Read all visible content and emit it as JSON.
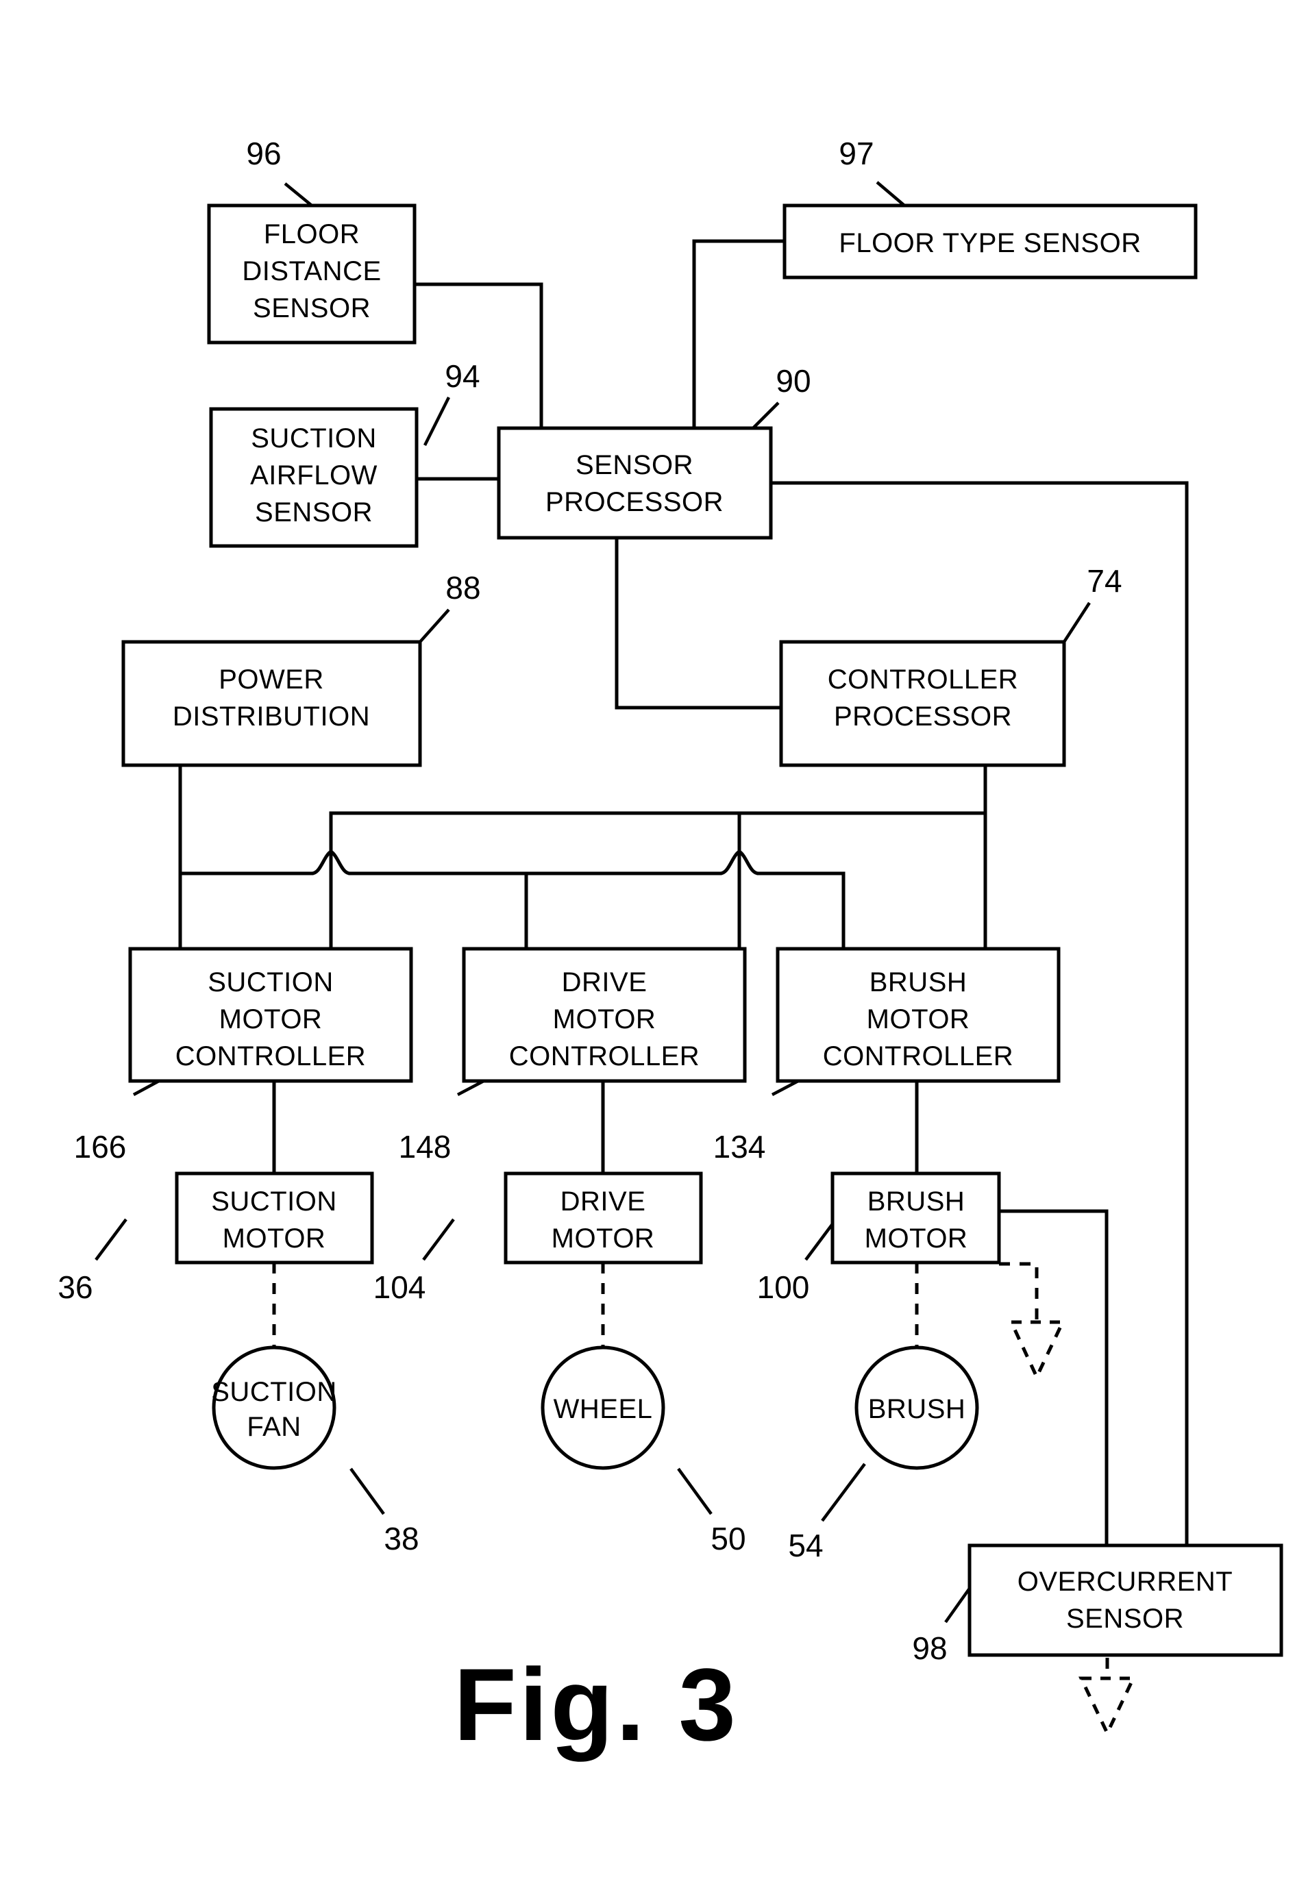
{
  "figure": {
    "caption": "Fig. 3",
    "title": "Vacuum cleaner control system block diagram"
  },
  "blocks": {
    "floor_distance_sensor": {
      "lines": [
        "FLOOR",
        "DISTANCE",
        "SENSOR"
      ],
      "ref": "96"
    },
    "floor_type_sensor": {
      "lines": [
        "FLOOR TYPE SENSOR"
      ],
      "ref": "97"
    },
    "suction_airflow_sensor": {
      "lines": [
        "SUCTION",
        "AIRFLOW",
        "SENSOR"
      ],
      "ref": "94"
    },
    "sensor_processor": {
      "lines": [
        "SENSOR",
        "PROCESSOR"
      ],
      "ref": "90"
    },
    "power_distribution": {
      "lines": [
        "POWER",
        "DISTRIBUTION"
      ],
      "ref": "88"
    },
    "controller_processor": {
      "lines": [
        "CONTROLLER",
        "PROCESSOR"
      ],
      "ref": "74"
    },
    "suction_motor_controller": {
      "lines": [
        "SUCTION",
        "MOTOR",
        "CONTROLLER"
      ],
      "ref": "166"
    },
    "drive_motor_controller": {
      "lines": [
        "DRIVE",
        "MOTOR",
        "CONTROLLER"
      ],
      "ref": "148"
    },
    "brush_motor_controller": {
      "lines": [
        "BRUSH",
        "MOTOR",
        "CONTROLLER"
      ],
      "ref": "134"
    },
    "suction_motor": {
      "lines": [
        "SUCTION",
        "MOTOR"
      ],
      "ref": "36"
    },
    "drive_motor": {
      "lines": [
        "DRIVE",
        "MOTOR"
      ],
      "ref": "104"
    },
    "brush_motor": {
      "lines": [
        "BRUSH",
        "MOTOR"
      ],
      "ref": "100"
    },
    "suction_fan": {
      "lines": [
        "SUCTION",
        "FAN"
      ],
      "ref": "38"
    },
    "wheel": {
      "lines": [
        "WHEEL"
      ],
      "ref": "50"
    },
    "brush": {
      "lines": [
        "BRUSH"
      ],
      "ref": "54"
    },
    "overcurrent_sensor": {
      "lines": [
        "OVERCURRENT",
        "SENSOR"
      ],
      "ref": "98"
    }
  },
  "labels": {
    "floor_distance_sensor_l1": "FLOOR",
    "floor_distance_sensor_l2": "DISTANCE",
    "floor_distance_sensor_l3": "SENSOR",
    "floor_type_sensor_l1": "FLOOR TYPE SENSOR",
    "suction_airflow_sensor_l1": "SUCTION",
    "suction_airflow_sensor_l2": "AIRFLOW",
    "suction_airflow_sensor_l3": "SENSOR",
    "sensor_processor_l1": "SENSOR",
    "sensor_processor_l2": "PROCESSOR",
    "power_distribution_l1": "POWER",
    "power_distribution_l2": "DISTRIBUTION",
    "controller_processor_l1": "CONTROLLER",
    "controller_processor_l2": "PROCESSOR",
    "suction_motor_controller_l1": "SUCTION",
    "suction_motor_controller_l2": "MOTOR",
    "suction_motor_controller_l3": "CONTROLLER",
    "drive_motor_controller_l1": "DRIVE",
    "drive_motor_controller_l2": "MOTOR",
    "drive_motor_controller_l3": "CONTROLLER",
    "brush_motor_controller_l1": "BRUSH",
    "brush_motor_controller_l2": "MOTOR",
    "brush_motor_controller_l3": "CONTROLLER",
    "suction_motor_l1": "SUCTION",
    "suction_motor_l2": "MOTOR",
    "drive_motor_l1": "DRIVE",
    "drive_motor_l2": "MOTOR",
    "brush_motor_l1": "BRUSH",
    "brush_motor_l2": "MOTOR",
    "suction_fan_l1": "SUCTION",
    "suction_fan_l2": "FAN",
    "wheel_l1": "WHEEL",
    "brush_l1": "BRUSH",
    "overcurrent_sensor_l1": "OVERCURRENT",
    "overcurrent_sensor_l2": "SENSOR"
  },
  "refs": {
    "r96": "96",
    "r97": "97",
    "r94": "94",
    "r90": "90",
    "r88": "88",
    "r74": "74",
    "r166": "166",
    "r148": "148",
    "r134": "134",
    "r36": "36",
    "r104": "104",
    "r100": "100",
    "r38": "38",
    "r50": "50",
    "r54": "54",
    "r98": "98"
  },
  "colors": {
    "ink": "#000000",
    "paper": "#ffffff"
  }
}
